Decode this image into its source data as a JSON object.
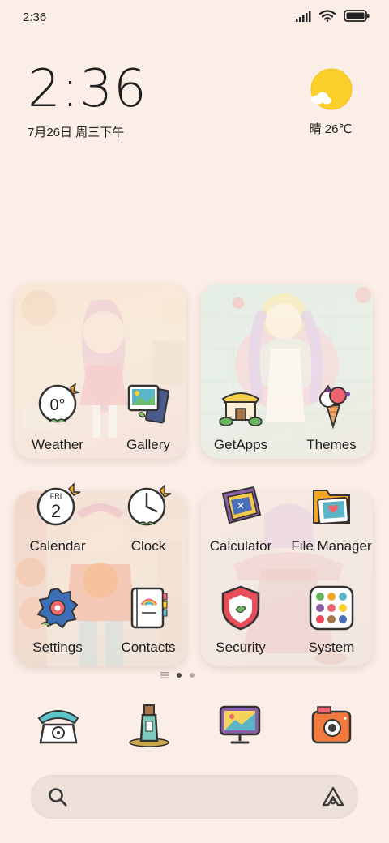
{
  "status_bar": {
    "time": "2:36",
    "signal": "signal-icon",
    "wifi": "wifi-icon",
    "battery": "battery-icon"
  },
  "clock_widget": {
    "time": "2:36",
    "date": "7月26日 周三下午"
  },
  "weather_widget": {
    "icon": "sun-cloud-icon",
    "text": "晴 26℃"
  },
  "folders": [
    {
      "apps": [
        {
          "label": "Weather",
          "icon": "weather-icon",
          "badge": "0°"
        },
        {
          "label": "Gallery",
          "icon": "gallery-icon"
        }
      ]
    },
    {
      "apps": [
        {
          "label": "GetApps",
          "icon": "getapps-icon"
        },
        {
          "label": "Themes",
          "icon": "themes-icon"
        }
      ]
    },
    {
      "apps": [
        {
          "label": "Calendar",
          "icon": "calendar-icon",
          "day_abbr": "FRI",
          "day_num": "2"
        },
        {
          "label": "Clock",
          "icon": "clock-icon"
        },
        {
          "label": "Settings",
          "icon": "settings-icon"
        },
        {
          "label": "Contacts",
          "icon": "contacts-icon"
        }
      ]
    },
    {
      "apps": [
        {
          "label": "Calculator",
          "icon": "calculator-icon"
        },
        {
          "label": "File Manager",
          "icon": "file-manager-icon"
        },
        {
          "label": "Security",
          "icon": "security-icon"
        },
        {
          "label": "System",
          "icon": "system-folder-icon"
        }
      ]
    }
  ],
  "page_indicator": {
    "pages": 2,
    "current": 1
  },
  "dock": [
    {
      "name": "Phone",
      "icon": "phone-icon"
    },
    {
      "name": "Messages",
      "icon": "message-bottle-icon"
    },
    {
      "name": "Browser",
      "icon": "browser-icon"
    },
    {
      "name": "Camera",
      "icon": "camera-icon"
    }
  ],
  "search_bar": {
    "search_icon": "search-icon",
    "assistant_icon": "assistant-icon"
  },
  "colors": {
    "background": "#fbeee7",
    "sun": "#fbd02a",
    "search_bar": "#ece0d8"
  }
}
